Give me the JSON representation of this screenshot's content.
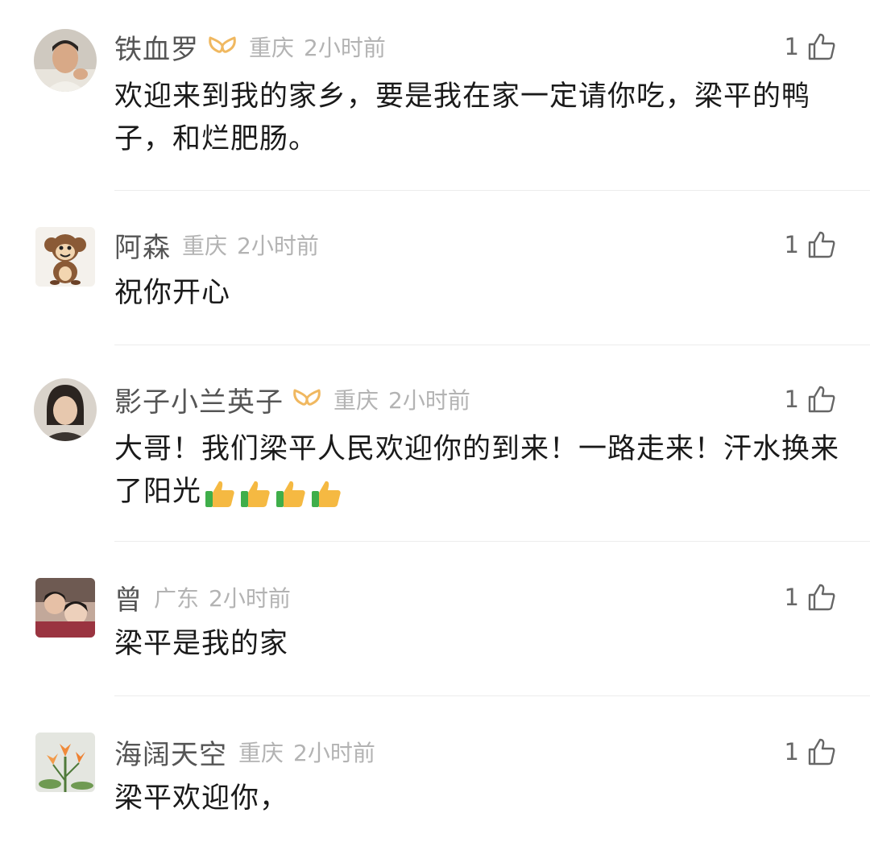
{
  "comments": [
    {
      "username": "铁血罗",
      "location": "重庆",
      "time": "2小时前",
      "likes": "1",
      "vip_badge": true,
      "text": "欢迎来到我的家乡，要是我在家一定请你吃，梁平的鸭子，和烂肥肠。"
    },
    {
      "username": "阿森",
      "location": "重庆",
      "time": "2小时前",
      "likes": "1",
      "vip_badge": false,
      "text": "祝你开心"
    },
    {
      "username": "影子小兰英子",
      "location": "重庆",
      "time": "2小时前",
      "likes": "1",
      "vip_badge": true,
      "text": "大哥！我们梁平人民欢迎你的到来！一路走来！汗水换来了阳光",
      "emoji": [
        "thumbs-up",
        "thumbs-up",
        "thumbs-up",
        "thumbs-up"
      ]
    },
    {
      "username": "曾",
      "location": "广东",
      "time": "2小时前",
      "likes": "1",
      "vip_badge": false,
      "text": "梁平是我的家"
    },
    {
      "username": "海阔天空",
      "location": "重庆",
      "time": "2小时前",
      "likes": "1",
      "vip_badge": false,
      "text": "梁平欢迎你，"
    }
  ],
  "icons": {
    "like": "thumbs-up-outline-icon",
    "badge": "vip-badge-icon"
  },
  "colors": {
    "username": "#555555",
    "meta": "#b3b3b3",
    "text": "#1a1a1a",
    "badge": "#f0b860",
    "divider": "#ececec"
  }
}
